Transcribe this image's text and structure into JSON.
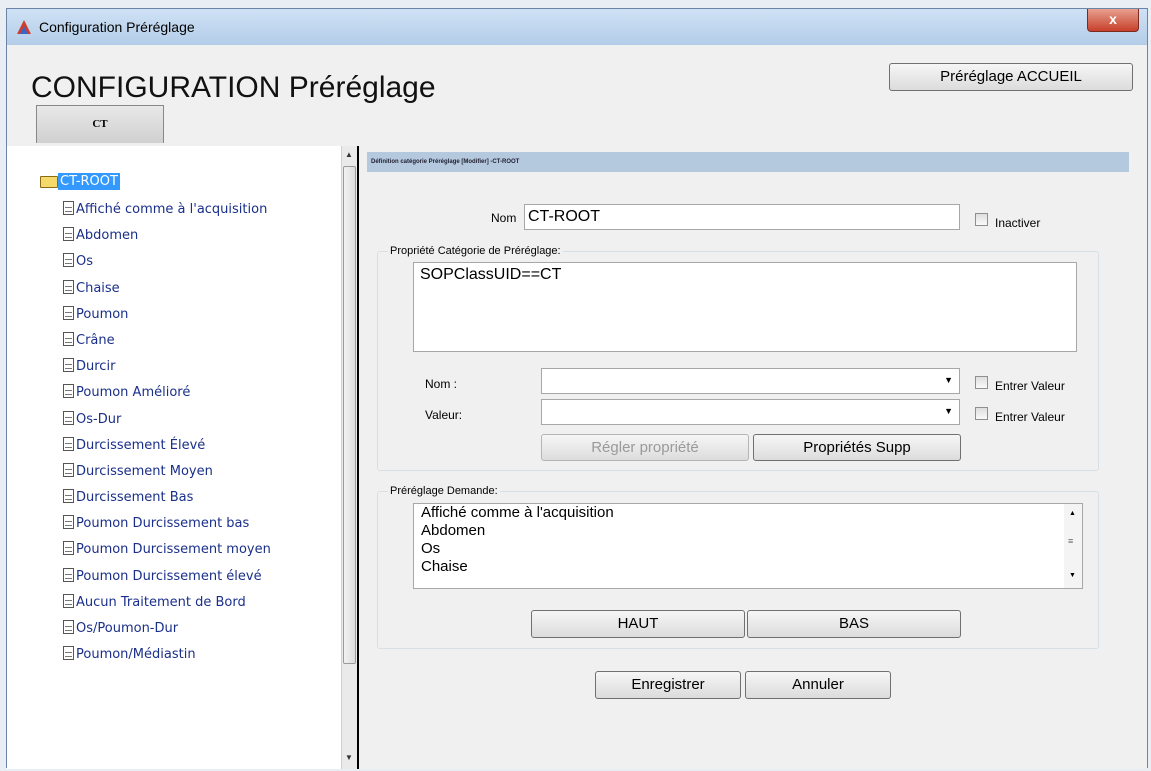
{
  "window": {
    "title": "Configuration Préréglage",
    "close_label": "x"
  },
  "header": {
    "page_title": "CONFIGURATION Préréglage",
    "home_button": "Préréglage ACCUEIL",
    "tab_label": "CT"
  },
  "tree": {
    "root_label": "CT-ROOT",
    "items": [
      "Affiché comme à l'acquisition",
      "Abdomen",
      "Os",
      "Chaise",
      "Poumon",
      "Crâne",
      "Durcir",
      "Poumon Amélioré",
      "Os-Dur",
      "Durcissement Élevé",
      "Durcissement Moyen",
      "Durcissement Bas",
      "Poumon Durcissement bas",
      "Poumon Durcissement moyen",
      "Poumon Durcissement élevé",
      "Aucun Traitement de Bord",
      "Os/Poumon-Dur",
      "Poumon/Médiastin"
    ]
  },
  "form": {
    "definition_bar": "Définition catégorie Préréglage [Modifier] -CT-ROOT",
    "name_label": "Nom",
    "name_value": "CT-ROOT",
    "inactivate_label": "Inactiver",
    "property_group_title": "Propriété Catégorie de Préréglage:",
    "property_text": "SOPClassUID==CT",
    "prop_name_label": "Nom :",
    "prop_value_label": "Valeur:",
    "enter_value_label": "Entrer Valeur",
    "set_property_button": "Régler propriété",
    "delete_properties_button": "Propriétés Supp",
    "request_group_title": "Préréglage Demande:",
    "request_items": [
      "Affiché comme à l'acquisition",
      "Abdomen",
      "Os",
      "Chaise"
    ],
    "up_button": "HAUT",
    "down_button": "BAS",
    "save_button": "Enregistrer",
    "cancel_button": "Annuler"
  }
}
